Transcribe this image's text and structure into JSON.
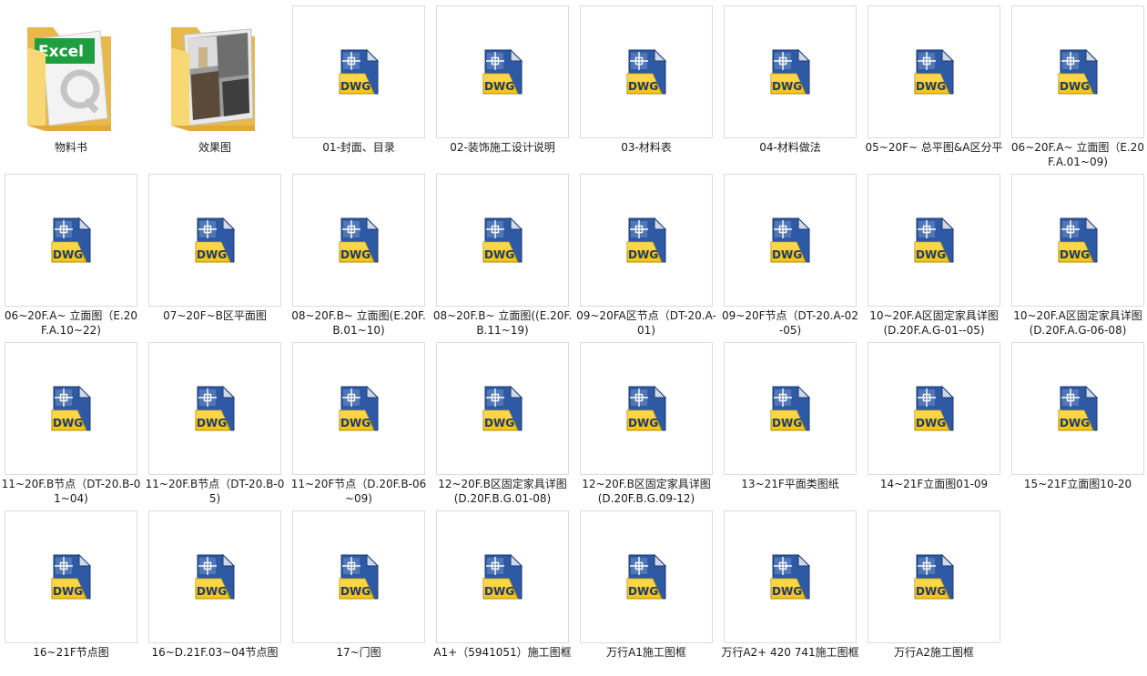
{
  "folders": [
    {
      "name": "物料书",
      "icon": "excel-folder-icon",
      "badge": "Excel"
    },
    {
      "name": "效果图",
      "icon": "image-folder-icon"
    }
  ],
  "files": [
    {
      "name": "01-封面、目录",
      "icon": "dwg-file-icon"
    },
    {
      "name": "02-装饰施工设计说明",
      "icon": "dwg-file-icon"
    },
    {
      "name": "03-材料表",
      "icon": "dwg-file-icon"
    },
    {
      "name": "04-材料做法",
      "icon": "dwg-file-icon"
    },
    {
      "name": "05~20F~ 总平图&A区分平",
      "icon": "dwg-file-icon"
    },
    {
      "name": "06~20F.A~ 立面图（E.20F.A.01~09)",
      "icon": "dwg-file-icon"
    },
    {
      "name": "06~20F.A~ 立面图（E.20F.A.10~22)",
      "icon": "dwg-file-icon"
    },
    {
      "name": "07~20F~B区平面图",
      "icon": "dwg-file-icon"
    },
    {
      "name": "08~20F.B~ 立面图(E.20F.B.01~10)",
      "icon": "dwg-file-icon"
    },
    {
      "name": "08~20F.B~ 立面图((E.20F.B.11~19)",
      "icon": "dwg-file-icon"
    },
    {
      "name": "09~20FA区节点（DT-20.A-01)",
      "icon": "dwg-file-icon"
    },
    {
      "name": "09~20F节点（DT-20.A-02-05)",
      "icon": "dwg-file-icon"
    },
    {
      "name": "10~20F.A区固定家具详图(D.20F.A.G-01--05)",
      "icon": "dwg-file-icon"
    },
    {
      "name": "10~20F.A区固定家具详图(D.20F.A.G-06-08)",
      "icon": "dwg-file-icon"
    },
    {
      "name": "11~20F.B节点（DT-20.B-01~04)",
      "icon": "dwg-file-icon"
    },
    {
      "name": "11~20F.B节点（DT-20.B-05)",
      "icon": "dwg-file-icon"
    },
    {
      "name": "11~20F节点（D.20F.B-06~09)",
      "icon": "dwg-file-icon"
    },
    {
      "name": "12~20F.B区固定家具详图(D.20F.B.G.01-08)",
      "icon": "dwg-file-icon"
    },
    {
      "name": "12~20F.B区固定家具详图(D.20F.B.G.09-12)",
      "icon": "dwg-file-icon"
    },
    {
      "name": "13~21F平面类图纸",
      "icon": "dwg-file-icon"
    },
    {
      "name": "14~21F立面图01-09",
      "icon": "dwg-file-icon"
    },
    {
      "name": "15~21F立面图10-20",
      "icon": "dwg-file-icon"
    },
    {
      "name": "16~21F节点图",
      "icon": "dwg-file-icon"
    },
    {
      "name": "16~D.21F.03~04节点图",
      "icon": "dwg-file-icon"
    },
    {
      "name": "17~门图",
      "icon": "dwg-file-icon"
    },
    {
      "name": "A1+（5941051）施工图框",
      "icon": "dwg-file-icon"
    },
    {
      "name": "万行A1施工图框",
      "icon": "dwg-file-icon"
    },
    {
      "name": "万行A2+ 420 741施工图框",
      "icon": "dwg-file-icon"
    },
    {
      "name": "万行A2施工图框",
      "icon": "dwg-file-icon"
    }
  ],
  "dwg_badge_text": "DWG",
  "colors": {
    "folder_back": "#e8b84a",
    "folder_front": "#f8d775",
    "dwg_blue": "#2e5aa5",
    "dwg_yellow": "#f5c518",
    "excel_green": "#1e9e3e"
  }
}
